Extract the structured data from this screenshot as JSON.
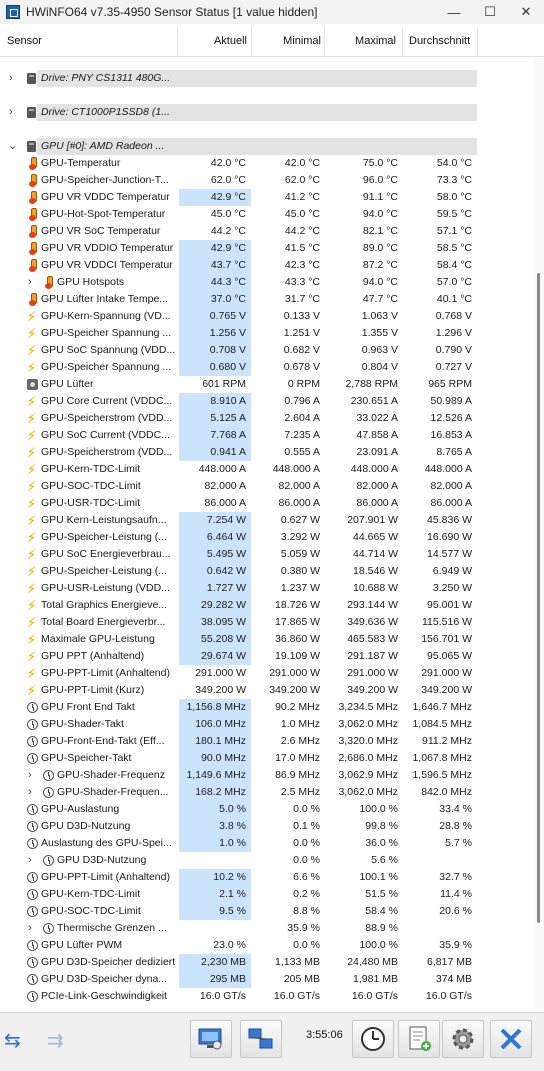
{
  "window": {
    "title": "HWiNFO64 v7.35-4950 Sensor Status [1 value hidden]",
    "minimize": "—",
    "maximize": "☐",
    "close": "✕"
  },
  "columns": {
    "sensor": "Sensor",
    "current": "Aktuell",
    "min": "Minimal",
    "max": "Maximal",
    "avg": "Durchschnitt"
  },
  "groups": [
    {
      "label": "Drive: PNY CS1311 480G...",
      "expanded": false
    },
    {
      "label": "Drive: CT1000P1SSD8 (1...",
      "expanded": false
    },
    {
      "label": "GPU [#0]: AMD Radeon ...",
      "expanded": true
    }
  ],
  "rows": [
    {
      "icon": "temp",
      "name": "GPU-Temperatur",
      "cur": "42.0 °C",
      "min": "42.0 °C",
      "max": "75.0 °C",
      "avg": "54.0 °C",
      "hl": false,
      "sub": false
    },
    {
      "icon": "temp",
      "name": "GPU-Speicher-Junction-T...",
      "cur": "62.0 °C",
      "min": "62.0 °C",
      "max": "96.0 °C",
      "avg": "73.3 °C",
      "hl": false,
      "sub": false
    },
    {
      "icon": "temp",
      "name": "GPU VR VDDC Temperatur",
      "cur": "42.9 °C",
      "min": "41.2 °C",
      "max": "91.1 °C",
      "avg": "58.0 °C",
      "hl": true,
      "sub": false
    },
    {
      "icon": "temp",
      "name": "GPU-Hot-Spot-Temperatur",
      "cur": "45.0 °C",
      "min": "45.0 °C",
      "max": "94.0 °C",
      "avg": "59.5 °C",
      "hl": false,
      "sub": false
    },
    {
      "icon": "temp",
      "name": "GPU VR SoC Temperatur",
      "cur": "44.2 °C",
      "min": "44.2 °C",
      "max": "82.1 °C",
      "avg": "57.1 °C",
      "hl": false,
      "sub": false
    },
    {
      "icon": "temp",
      "name": "GPU VR VDDIO Temperatur",
      "cur": "42.9 °C",
      "min": "41.5 °C",
      "max": "89.0 °C",
      "avg": "58.5 °C",
      "hl": true,
      "sub": false
    },
    {
      "icon": "temp",
      "name": "GPU VR VDDCI Temperatur",
      "cur": "43.7 °C",
      "min": "42.3 °C",
      "max": "87.2 °C",
      "avg": "58.4 °C",
      "hl": true,
      "sub": false
    },
    {
      "icon": "temp",
      "name": "GPU Hotspots",
      "cur": "44.3 °C",
      "min": "43.3 °C",
      "max": "94.0 °C",
      "avg": "57.0 °C",
      "hl": true,
      "sub": true
    },
    {
      "icon": "temp",
      "name": "GPU Lüfter Intake Tempe...",
      "cur": "37.0 °C",
      "min": "31.7 °C",
      "max": "47.7 °C",
      "avg": "40.1 °C",
      "hl": true,
      "sub": false
    },
    {
      "icon": "volt",
      "name": "GPU-Kern-Spannung (VD...",
      "cur": "0.765 V",
      "min": "0.133 V",
      "max": "1.063 V",
      "avg": "0.768 V",
      "hl": true,
      "sub": false
    },
    {
      "icon": "volt",
      "name": "GPU-Speicher Spannung ...",
      "cur": "1.256 V",
      "min": "1.251 V",
      "max": "1.355 V",
      "avg": "1.296 V",
      "hl": true,
      "sub": false
    },
    {
      "icon": "volt",
      "name": "GPU SoC Spannung (VDD...",
      "cur": "0.708 V",
      "min": "0.682 V",
      "max": "0.963 V",
      "avg": "0.790 V",
      "hl": true,
      "sub": false
    },
    {
      "icon": "volt",
      "name": "GPU-Speicher Spannung ...",
      "cur": "0.680 V",
      "min": "0.678 V",
      "max": "0.804 V",
      "avg": "0.727 V",
      "hl": true,
      "sub": false
    },
    {
      "icon": "fan",
      "name": "GPU Lüfter",
      "cur": "601 RPM",
      "min": "0 RPM",
      "max": "2,788 RPM",
      "avg": "965 RPM",
      "hl": false,
      "sub": false
    },
    {
      "icon": "volt",
      "name": "GPU Core Current (VDDC...",
      "cur": "8.910 A",
      "min": "0.796 A",
      "max": "230.651 A",
      "avg": "50.989 A",
      "hl": true,
      "sub": false
    },
    {
      "icon": "volt",
      "name": "GPU-Speicherstrom (VDD...",
      "cur": "5.125 A",
      "min": "2.604 A",
      "max": "33.022 A",
      "avg": "12.526 A",
      "hl": true,
      "sub": false
    },
    {
      "icon": "volt",
      "name": "GPU SoC Current (VDDC...",
      "cur": "7.768 A",
      "min": "7.235 A",
      "max": "47.858 A",
      "avg": "16.853 A",
      "hl": true,
      "sub": false
    },
    {
      "icon": "volt",
      "name": "GPU-Speicherstrom (VDD...",
      "cur": "0.941 A",
      "min": "0.555 A",
      "max": "23.091 A",
      "avg": "8.765 A",
      "hl": true,
      "sub": false
    },
    {
      "icon": "volt",
      "name": "GPU-Kern-TDC-Limit",
      "cur": "448.000 A",
      "min": "448.000 A",
      "max": "448.000 A",
      "avg": "448.000 A",
      "hl": false,
      "sub": false
    },
    {
      "icon": "volt",
      "name": "GPU-SOC-TDC-Limit",
      "cur": "82.000 A",
      "min": "82.000 A",
      "max": "82.000 A",
      "avg": "82.000 A",
      "hl": false,
      "sub": false
    },
    {
      "icon": "volt",
      "name": "GPU-USR-TDC-Limit",
      "cur": "86.000 A",
      "min": "86.000 A",
      "max": "86.000 A",
      "avg": "86.000 A",
      "hl": false,
      "sub": false
    },
    {
      "icon": "volt",
      "name": "GPU Kern-Leistungsaufn...",
      "cur": "7.254 W",
      "min": "0.627 W",
      "max": "207.901 W",
      "avg": "45.836 W",
      "hl": true,
      "sub": false
    },
    {
      "icon": "volt",
      "name": "GPU-Speicher-Leistung (...",
      "cur": "6.464 W",
      "min": "3.292 W",
      "max": "44.665 W",
      "avg": "16.690 W",
      "hl": true,
      "sub": false
    },
    {
      "icon": "volt",
      "name": "GPU SoC Energieverbrau...",
      "cur": "5.495 W",
      "min": "5.059 W",
      "max": "44.714 W",
      "avg": "14.577 W",
      "hl": true,
      "sub": false
    },
    {
      "icon": "volt",
      "name": "GPU-Speicher-Leistung (...",
      "cur": "0.642 W",
      "min": "0.380 W",
      "max": "18.546 W",
      "avg": "6.949 W",
      "hl": true,
      "sub": false
    },
    {
      "icon": "volt",
      "name": "GPU-USR-Leistung (VDD...",
      "cur": "1.727 W",
      "min": "1.237 W",
      "max": "10.688 W",
      "avg": "3.250 W",
      "hl": true,
      "sub": false
    },
    {
      "icon": "volt",
      "name": "Total Graphics Energieve...",
      "cur": "29.282 W",
      "min": "18.726 W",
      "max": "293.144 W",
      "avg": "95.001 W",
      "hl": true,
      "sub": false
    },
    {
      "icon": "volt",
      "name": "Total Board Energieverbr...",
      "cur": "38.095 W",
      "min": "17.865 W",
      "max": "349.636 W",
      "avg": "115.516 W",
      "hl": true,
      "sub": false
    },
    {
      "icon": "volt",
      "name": "Maximale GPU-Leistung",
      "cur": "55.208 W",
      "min": "36.860 W",
      "max": "465.583 W",
      "avg": "156.701 W",
      "hl": true,
      "sub": false
    },
    {
      "icon": "volt",
      "name": "GPU PPT (Anhaltend)",
      "cur": "29.674 W",
      "min": "19.109 W",
      "max": "291.187 W",
      "avg": "95.065 W",
      "hl": true,
      "sub": false
    },
    {
      "icon": "volt",
      "name": "GPU-PPT-Limit (Anhaltend)",
      "cur": "291.000 W",
      "min": "291.000 W",
      "max": "291.000 W",
      "avg": "291.000 W",
      "hl": false,
      "sub": false
    },
    {
      "icon": "volt",
      "name": "GPU-PPT-Limit (Kurz)",
      "cur": "349.200 W",
      "min": "349.200 W",
      "max": "349.200 W",
      "avg": "349.200 W",
      "hl": false,
      "sub": false
    },
    {
      "icon": "clock",
      "name": "GPU Front End Takt",
      "cur": "1,156.8 MHz",
      "min": "90.2 MHz",
      "max": "3,234.5 MHz",
      "avg": "1,646.7 MHz",
      "hl": true,
      "sub": false
    },
    {
      "icon": "clock",
      "name": "GPU-Shader-Takt",
      "cur": "106.0 MHz",
      "min": "1.0 MHz",
      "max": "3,062.0 MHz",
      "avg": "1,084.5 MHz",
      "hl": true,
      "sub": false
    },
    {
      "icon": "clock",
      "name": "GPU-Front-End-Takt (Eff...",
      "cur": "180.1 MHz",
      "min": "2.6 MHz",
      "max": "3,320.0 MHz",
      "avg": "911.2 MHz",
      "hl": true,
      "sub": false
    },
    {
      "icon": "clock",
      "name": "GPU-Speicher-Takt",
      "cur": "90.0 MHz",
      "min": "17.0 MHz",
      "max": "2,686.0 MHz",
      "avg": "1,067.8 MHz",
      "hl": true,
      "sub": false
    },
    {
      "icon": "clock",
      "name": "GPU-Shader-Frequenz",
      "cur": "1,149.6 MHz",
      "min": "86.9 MHz",
      "max": "3,062.9 MHz",
      "avg": "1,596.5 MHz",
      "hl": true,
      "sub": true
    },
    {
      "icon": "clock",
      "name": "GPU-Shader-Frequen...",
      "cur": "168.2 MHz",
      "min": "2.5 MHz",
      "max": "3,062.0 MHz",
      "avg": "842.0 MHz",
      "hl": true,
      "sub": true
    },
    {
      "icon": "clock",
      "name": "GPU-Auslastung",
      "cur": "5.0 %",
      "min": "0.0 %",
      "max": "100.0 %",
      "avg": "33.4 %",
      "hl": true,
      "sub": false
    },
    {
      "icon": "clock",
      "name": "GPU D3D-Nutzung",
      "cur": "3.8 %",
      "min": "0.1 %",
      "max": "99.8 %",
      "avg": "28.8 %",
      "hl": true,
      "sub": false
    },
    {
      "icon": "clock",
      "name": "Auslastung des GPU-Spei...",
      "cur": "1.0 %",
      "min": "0.0 %",
      "max": "36.0 %",
      "avg": "5.7 %",
      "hl": true,
      "sub": false
    },
    {
      "icon": "clock",
      "name": "GPU D3D-Nutzung",
      "cur": "",
      "min": "0.0 %",
      "max": "5.6 %",
      "avg": "",
      "hl": false,
      "sub": true
    },
    {
      "icon": "clock",
      "name": "GPU-PPT-Limit (Anhaltend)",
      "cur": "10.2 %",
      "min": "6.6 %",
      "max": "100.1 %",
      "avg": "32.7 %",
      "hl": true,
      "sub": false
    },
    {
      "icon": "clock",
      "name": "GPU-Kern-TDC-Limit",
      "cur": "2.1 %",
      "min": "0.2 %",
      "max": "51.5 %",
      "avg": "11.4 %",
      "hl": true,
      "sub": false
    },
    {
      "icon": "clock",
      "name": "GPU-SOC-TDC-Limit",
      "cur": "9.5 %",
      "min": "8.8 %",
      "max": "58.4 %",
      "avg": "20.6 %",
      "hl": true,
      "sub": false
    },
    {
      "icon": "clock",
      "name": "Thermische Grenzen ...",
      "cur": "",
      "min": "35.9 %",
      "max": "88.9 %",
      "avg": "",
      "hl": false,
      "sub": true
    },
    {
      "icon": "clock",
      "name": "GPU Lüfter PWM",
      "cur": "23.0 %",
      "min": "0.0 %",
      "max": "100.0 %",
      "avg": "35.9 %",
      "hl": false,
      "sub": false
    },
    {
      "icon": "clock",
      "name": "GPU D3D-Speicher dediziert",
      "cur": "2,230 MB",
      "min": "1,133 MB",
      "max": "24,480 MB",
      "avg": "6,817 MB",
      "hl": true,
      "sub": false
    },
    {
      "icon": "clock",
      "name": "GPU D3D-Speicher dyna...",
      "cur": "295 MB",
      "min": "205 MB",
      "max": "1,981 MB",
      "avg": "374 MB",
      "hl": true,
      "sub": false
    },
    {
      "icon": "clock",
      "name": "PCIe-Link-Geschwindigkeit",
      "cur": "16.0 GT/s",
      "min": "16.0 GT/s",
      "max": "16.0 GT/s",
      "avg": "16.0 GT/s",
      "hl": false,
      "sub": false
    }
  ],
  "toolbar": {
    "time": "3:55:06"
  }
}
